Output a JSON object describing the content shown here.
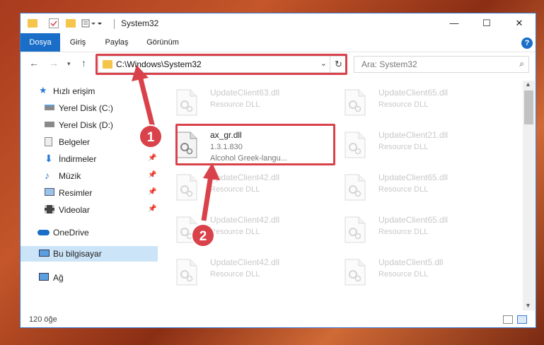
{
  "window": {
    "title": "System32",
    "minimize": "—",
    "maximize": "☐",
    "close": "✕"
  },
  "ribbon": {
    "tabs": [
      "Dosya",
      "Giriş",
      "Paylaş",
      "Görünüm"
    ],
    "help": "?"
  },
  "address": {
    "path": "C:\\Windows\\System32",
    "search_placeholder": "Ara: System32"
  },
  "nav": {
    "items": [
      {
        "label": "Hızlı erişim",
        "icon": "star-icon",
        "pinned": false
      },
      {
        "label": "Yerel Disk (C:)",
        "icon": "drive-icon",
        "pinned": false
      },
      {
        "label": "Yerel Disk (D:)",
        "icon": "drive-icon",
        "pinned": false
      },
      {
        "label": "Belgeler",
        "icon": "documents-icon",
        "pinned": false
      },
      {
        "label": "İndirmeler",
        "icon": "download-icon",
        "pinned": true
      },
      {
        "label": "Müzik",
        "icon": "music-icon",
        "pinned": true
      },
      {
        "label": "Resimler",
        "icon": "pictures-icon",
        "pinned": true
      },
      {
        "label": "Videolar",
        "icon": "video-icon",
        "pinned": true
      },
      {
        "label": "OneDrive",
        "icon": "cloud-icon",
        "pinned": false
      },
      {
        "label": "Bu bilgisayar",
        "icon": "computer-icon",
        "pinned": false
      },
      {
        "label": "Ağ",
        "icon": "network-icon",
        "pinned": false
      }
    ]
  },
  "files": {
    "left": [
      {
        "name": "UpdateClient63.dll",
        "sub": "Resource DLL"
      },
      {
        "name": "ax_gr.dll",
        "version": "1.3.1.830",
        "sub": "Alcohol Greek-langu..."
      },
      {
        "name": "UpdateClient42.dll",
        "sub": "Resource DLL"
      },
      {
        "name": "UpdateClient42.dll",
        "sub": "Resource DLL"
      },
      {
        "name": "UpdateClient42.dll",
        "sub": "Resource DLL"
      }
    ],
    "right": [
      {
        "name": "UpdateClient65.dll",
        "sub": "Resource DLL"
      },
      {
        "name": "UpdateClient21.dll",
        "sub": "Resource DLL"
      },
      {
        "name": "UpdateClient65.dll",
        "sub": "Resource DLL"
      },
      {
        "name": "UpdateClient65.dll",
        "sub": "Resource DLL"
      },
      {
        "name": "UpdateClient5.dll",
        "sub": "Resource DLL"
      }
    ]
  },
  "status": {
    "count": "120 öğe"
  },
  "callouts": [
    "1",
    "2"
  ],
  "colors": {
    "accent": "#1a6ec8",
    "highlight": "#d9424a",
    "folder": "#f5c54b"
  }
}
